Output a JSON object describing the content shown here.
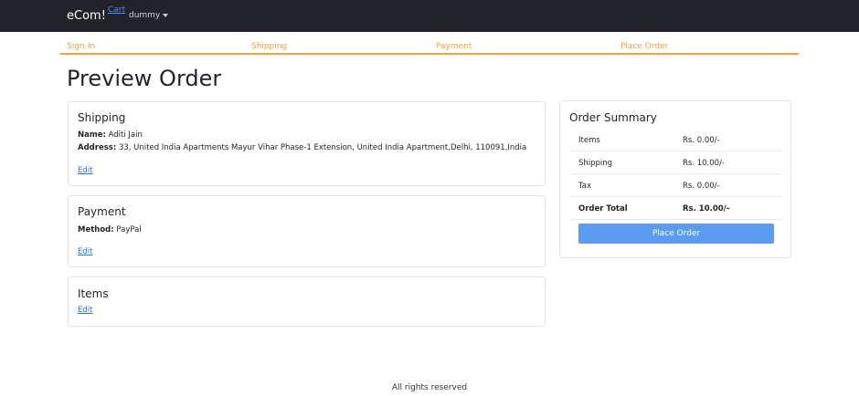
{
  "navbar": {
    "brand": "eCom!",
    "cart": "Cart",
    "user": "dummy"
  },
  "steps": [
    "Sign-In",
    "Shipping",
    "Payment",
    "Place Order"
  ],
  "page_title": "Preview Order",
  "shipping": {
    "title": "Shipping",
    "name_label": "Name:",
    "name": "Aditi Jain",
    "address_label": "Address:",
    "address": "33, United India Apartments Mayur Vihar Phase-1 Extension, United India Apartment,Delhi, 110091,India",
    "edit": "Edit"
  },
  "payment": {
    "title": "Payment",
    "method_label": "Method:",
    "method": "PayPal",
    "edit": "Edit"
  },
  "items": {
    "title": "Items",
    "edit": "Edit"
  },
  "summary": {
    "title": "Order Summary",
    "rows": [
      {
        "label": "Items",
        "value": "Rs. 0.00/-"
      },
      {
        "label": "Shipping",
        "value": "Rs. 10.00/-"
      },
      {
        "label": "Tax",
        "value": "Rs. 0.00/-"
      },
      {
        "label": "Order Total",
        "value": "Rs. 10.00/-"
      }
    ],
    "button": "Place Order"
  },
  "footer": "All rights reserved"
}
